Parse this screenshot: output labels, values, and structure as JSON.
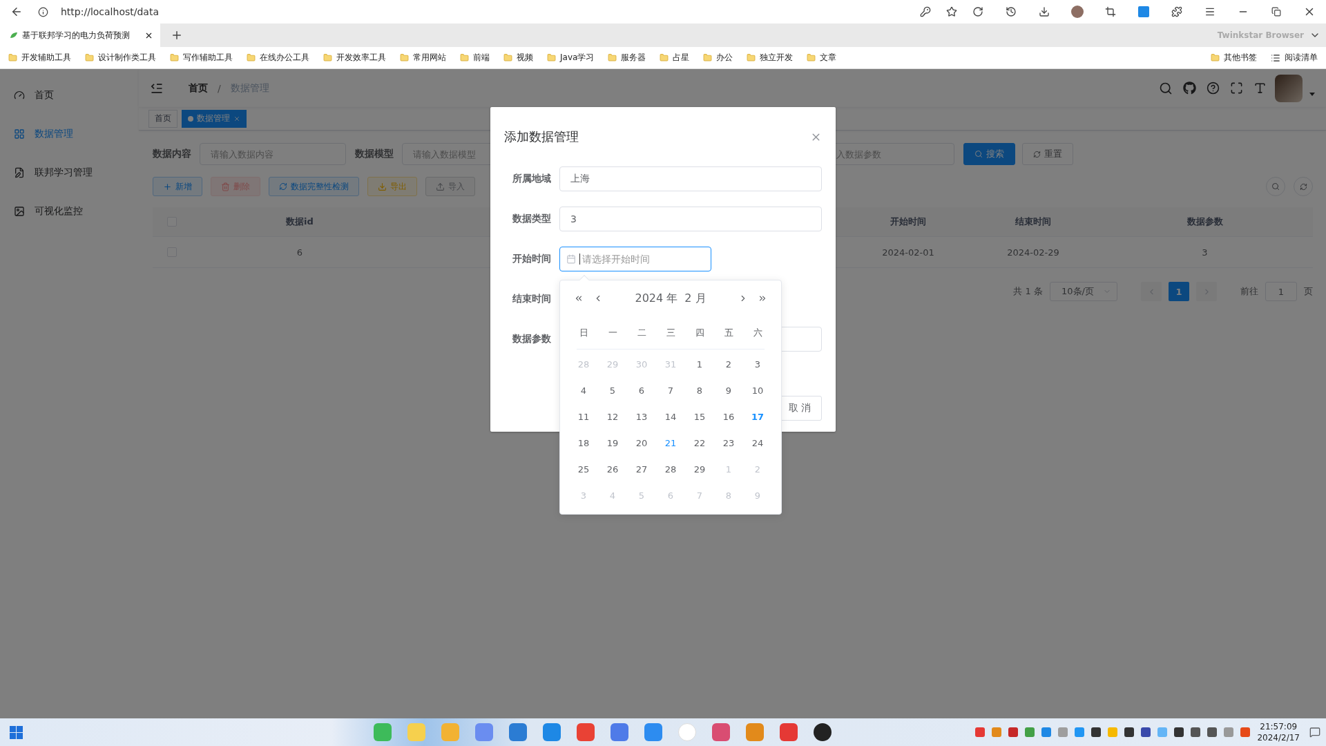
{
  "browser": {
    "url": "http://localhost/data",
    "tab_title": "基于联邦学习的电力负荷预测",
    "brand": "Twinkstar Browser",
    "bookmarks": [
      "开发辅助工具",
      "设计制作类工具",
      "写作辅助工具",
      "在线办公工具",
      "开发效率工具",
      "常用网站",
      "前端",
      "视频",
      "Java学习",
      "服务器",
      "占星",
      "办公",
      "独立开发",
      "文章"
    ],
    "bookmarks_right": [
      {
        "label": "其他书签",
        "kind": "folder"
      },
      {
        "label": "阅读清单",
        "kind": "list"
      }
    ]
  },
  "sidebar": {
    "items": [
      {
        "label": "首页",
        "selected": false
      },
      {
        "label": "数据管理",
        "selected": true
      },
      {
        "label": "联邦学习管理",
        "selected": false
      },
      {
        "label": "可视化监控",
        "selected": false
      }
    ]
  },
  "breadcrumb_separator": "/",
  "breadcrumbs": [
    {
      "label": "首页",
      "current": false
    },
    {
      "label": "数据管理",
      "current": true
    }
  ],
  "tags": [
    {
      "label": "首页",
      "selected": false
    },
    {
      "label": "数据管理",
      "selected": true
    }
  ],
  "search_form": {
    "fields": [
      {
        "label": "数据内容",
        "placeholder": "请输入数据内容"
      },
      {
        "label": "数据模型",
        "placeholder": "请输入数据模型"
      },
      {
        "placeholder": "入数据参数"
      }
    ],
    "search": "搜索",
    "reset": "重置"
  },
  "toolbar": [
    {
      "label": "新增",
      "kind": "primary"
    },
    {
      "label": "删除",
      "kind": "danger"
    },
    {
      "label": "数据完整性检测",
      "kind": "info"
    },
    {
      "label": "导出",
      "kind": "warning"
    },
    {
      "label": "导入",
      "kind": "default"
    }
  ],
  "table": {
    "select_all_checked": false,
    "columns": [
      "数据id",
      "开始时间",
      "结束时间",
      "数据参数"
    ],
    "rows": [
      {
        "checked": false,
        "cells": [
          "6",
          "2024-02-01",
          "2024-02-29",
          "3"
        ]
      }
    ]
  },
  "pagination": {
    "total": "共 1 条",
    "page_size": "10条/页",
    "pages": [
      {
        "label": "1",
        "selected": true
      }
    ],
    "goto_label": "前往",
    "goto_value": "1",
    "page_unit": "页"
  },
  "dialog": {
    "title": "添加数据管理",
    "fields": [
      {
        "label": "所属地域",
        "kind": "text",
        "value": "上海"
      },
      {
        "label": "数据类型",
        "kind": "text",
        "value": "3"
      },
      {
        "label": "开始时间",
        "kind": "date",
        "placeholder": "请选择开始时间",
        "focused": true
      },
      {
        "label": "结束时间",
        "kind": "covered"
      },
      {
        "label": "数据参数",
        "kind": "text"
      }
    ],
    "cancel": "取 消"
  },
  "date_picker": {
    "year": "2024 年",
    "month": "2 月",
    "weekdays": [
      "日",
      "一",
      "二",
      "三",
      "四",
      "五",
      "六"
    ],
    "weeks": [
      [
        {
          "text": "28",
          "kind": "other"
        },
        {
          "text": "29",
          "kind": "other"
        },
        {
          "text": "30",
          "kind": "other"
        },
        {
          "text": "31",
          "kind": "other"
        },
        {
          "text": "1",
          "kind": "current"
        },
        {
          "text": "2",
          "kind": "current"
        },
        {
          "text": "3",
          "kind": "current"
        }
      ],
      [
        {
          "text": "4",
          "kind": "current"
        },
        {
          "text": "5",
          "kind": "current"
        },
        {
          "text": "6",
          "kind": "current"
        },
        {
          "text": "7",
          "kind": "current"
        },
        {
          "text": "8",
          "kind": "current"
        },
        {
          "text": "9",
          "kind": "current"
        },
        {
          "text": "10",
          "kind": "current"
        }
      ],
      [
        {
          "text": "11",
          "kind": "current"
        },
        {
          "text": "12",
          "kind": "current"
        },
        {
          "text": "13",
          "kind": "current"
        },
        {
          "text": "14",
          "kind": "current"
        },
        {
          "text": "15",
          "kind": "current"
        },
        {
          "text": "16",
          "kind": "current"
        },
        {
          "text": "17",
          "kind": "today"
        }
      ],
      [
        {
          "text": "18",
          "kind": "current"
        },
        {
          "text": "19",
          "kind": "current"
        },
        {
          "text": "20",
          "kind": "current"
        },
        {
          "text": "21",
          "kind": "hover"
        },
        {
          "text": "22",
          "kind": "current"
        },
        {
          "text": "23",
          "kind": "current"
        },
        {
          "text": "24",
          "kind": "current"
        }
      ],
      [
        {
          "text": "25",
          "kind": "current"
        },
        {
          "text": "26",
          "kind": "current"
        },
        {
          "text": "27",
          "kind": "current"
        },
        {
          "text": "28",
          "kind": "current"
        },
        {
          "text": "29",
          "kind": "current"
        },
        {
          "text": "1",
          "kind": "other"
        },
        {
          "text": "2",
          "kind": "other"
        }
      ],
      [
        {
          "text": "3",
          "kind": "other"
        },
        {
          "text": "4",
          "kind": "other"
        },
        {
          "text": "5",
          "kind": "other"
        },
        {
          "text": "6",
          "kind": "other"
        },
        {
          "text": "7",
          "kind": "other"
        },
        {
          "text": "8",
          "kind": "other"
        },
        {
          "text": "9",
          "kind": "other"
        }
      ]
    ]
  },
  "taskbar": {
    "time": "21:57:09",
    "date": "2024/2/17"
  }
}
